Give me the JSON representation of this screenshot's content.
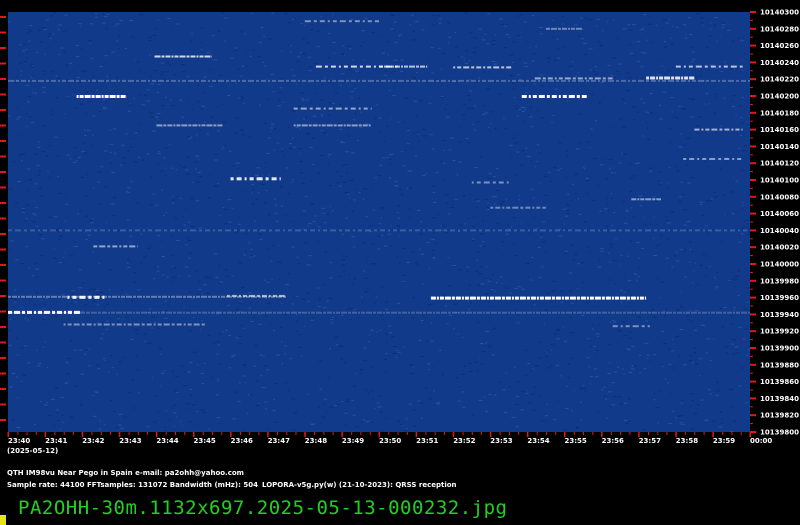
{
  "colors": {
    "background": "#000000",
    "plot_bg": "#123a8a",
    "signal": "#ffffff",
    "tick_red": "#e01818",
    "text": "#ffffff",
    "filename": "#21d121",
    "cursor": "#e7e51a"
  },
  "time_labels": [
    "23:40",
    "23:41",
    "23:42",
    "23:43",
    "23:44",
    "23:45",
    "23:46",
    "23:47",
    "23:48",
    "23:49",
    "23:50",
    "23:51",
    "23:52",
    "23:53",
    "23:54",
    "23:55",
    "23:56",
    "23:57",
    "23:58",
    "23:59",
    "00:00"
  ],
  "date_label": "(2025-05-12)",
  "freq_labels": [
    "10140300",
    "10140280",
    "10140260",
    "10140240",
    "10140220",
    "10140200",
    "10140180",
    "10140160",
    "10140140",
    "10140120",
    "10140100",
    "10140080",
    "10140060",
    "10140040",
    "10140020",
    "10140000",
    "10139980",
    "10139960",
    "10139940",
    "10139920",
    "10139900",
    "10139880",
    "10139860",
    "10139840",
    "10139820",
    "10139800"
  ],
  "footer": {
    "line1": "QTH IM98vu Near Pego in Spain   e-mail: pa2ohh@yahoo.com",
    "line2_left": "Sample rate: 44100    FFTsamples: 131072    Bandwidth (mHz): 504",
    "line2_right": "LOPORA-v5g.py(w) (21-10-2023): QRSS reception"
  },
  "filename": "PA2OHH-30m.1132x697.2025-05-13-000232.jpg",
  "signals": [
    {
      "t0": 1.85,
      "t1": 3.2,
      "f": 10140200,
      "bright": 1.0
    },
    {
      "t0": 13.85,
      "t1": 15.6,
      "f": 10140200,
      "bright": 1.0
    },
    {
      "t0": 6.0,
      "t1": 7.35,
      "f": 10140102,
      "bright": 0.9
    },
    {
      "t0": 3.95,
      "t1": 5.5,
      "f": 10140247,
      "bright": 0.8
    },
    {
      "t0": 0.0,
      "t1": 2.0,
      "f": 10139943,
      "bright": 0.95
    },
    {
      "t0": 1.6,
      "t1": 2.6,
      "f": 10139961,
      "bright": 0.95
    },
    {
      "t0": 11.4,
      "t1": 17.2,
      "f": 10139960,
      "bright": 1.0
    },
    {
      "t0": 5.9,
      "t1": 7.5,
      "f": 10139962,
      "bright": 0.6
    },
    {
      "t0": 8.3,
      "t1": 10.5,
      "f": 10140235,
      "bright": 0.8
    },
    {
      "t0": 10.0,
      "t1": 11.3,
      "f": 10140235,
      "bright": 0.7
    },
    {
      "t0": 12.0,
      "t1": 13.6,
      "f": 10140234,
      "bright": 0.7
    },
    {
      "t0": 18.0,
      "t1": 19.8,
      "f": 10140235,
      "bright": 0.7
    },
    {
      "t0": 17.2,
      "t1": 18.5,
      "f": 10140222,
      "bright": 0.85
    },
    {
      "t0": 14.2,
      "t1": 16.3,
      "f": 10140221,
      "bright": 0.55
    },
    {
      "t0": 7.7,
      "t1": 9.8,
      "f": 10140185,
      "bright": 0.55
    },
    {
      "t0": 7.7,
      "t1": 9.8,
      "f": 10140165,
      "bright": 0.5
    },
    {
      "t0": 18.5,
      "t1": 19.8,
      "f": 10140160,
      "bright": 0.6
    },
    {
      "t0": 18.2,
      "t1": 19.8,
      "f": 10140125,
      "bright": 0.5
    },
    {
      "t0": 4.0,
      "t1": 5.8,
      "f": 10140165,
      "bright": 0.5
    },
    {
      "t0": 2.3,
      "t1": 3.5,
      "f": 10140021,
      "bright": 0.55
    },
    {
      "t0": 12.5,
      "t1": 13.5,
      "f": 10140097,
      "bright": 0.45
    },
    {
      "t0": 16.8,
      "t1": 17.6,
      "f": 10140077,
      "bright": 0.5
    },
    {
      "t0": 13.0,
      "t1": 14.5,
      "f": 10140067,
      "bright": 0.4
    },
    {
      "t0": 8.0,
      "t1": 10.0,
      "f": 10140289,
      "bright": 0.45
    },
    {
      "t0": 14.5,
      "t1": 15.5,
      "f": 10140280,
      "bright": 0.4
    },
    {
      "t0": 1.5,
      "t1": 5.3,
      "f": 10139928,
      "bright": 0.45
    },
    {
      "t0": 16.3,
      "t1": 17.3,
      "f": 10139926,
      "bright": 0.45
    },
    {
      "t0": 0.0,
      "t1": 7.5,
      "f": 10139961,
      "bright": 0.35
    },
    {
      "t0": 0.0,
      "t1": 20.0,
      "f": 10140218,
      "bright": 0.25
    },
    {
      "t0": 0.0,
      "t1": 20.0,
      "f": 10140040,
      "bright": 0.18
    },
    {
      "t0": 0.0,
      "t1": 20.0,
      "f": 10139942,
      "bright": 0.2
    }
  ]
}
